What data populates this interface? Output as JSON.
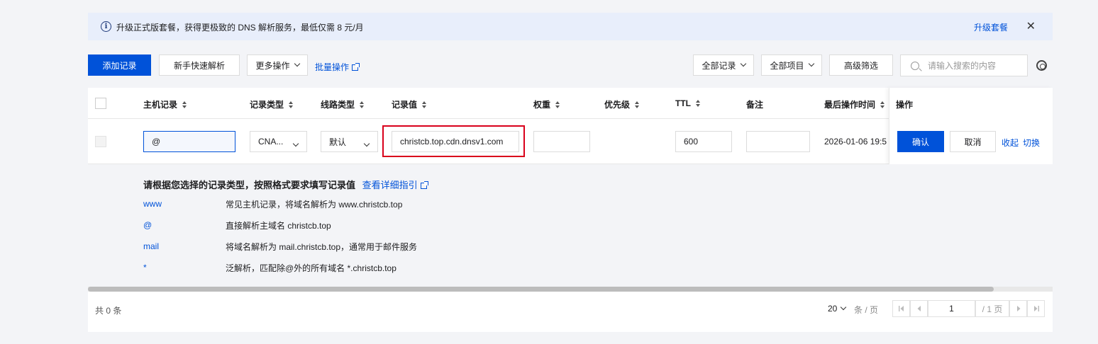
{
  "banner": {
    "message": "升级正式版套餐，获得更极致的 DNS 解析服务，最低仅需 8 元/月",
    "upgrade_link": "升级套餐",
    "close": "✕"
  },
  "toolbar": {
    "add_record": "添加记录",
    "quick_setup": "新手快速解析",
    "more_actions": "更多操作",
    "batch_ops": "批量操作",
    "filter_records": "全部记录",
    "filter_items": "全部项目",
    "advanced_filter": "高级筛选",
    "search_placeholder": "请输入搜索的内容"
  },
  "table": {
    "columns": [
      "主机记录",
      "记录类型",
      "线路类型",
      "记录值",
      "权重",
      "优先级",
      "TTL",
      "备注",
      "最后操作时间",
      "操作"
    ],
    "edit_row": {
      "host": "@",
      "type": "CNA...",
      "line": "默认",
      "value": "christcb.top.cdn.dnsv1.com",
      "weight": "",
      "ttl": "600",
      "remark": "",
      "last_modified": "2026-01-06 19:5",
      "confirm": "确认",
      "cancel": "取消",
      "collapse": "收起",
      "switch": "切换"
    }
  },
  "guide": {
    "title": "请根据您选择的记录类型，按照格式要求填写记录值",
    "detail_link": "查看详细指引",
    "examples": [
      {
        "key": "www",
        "desc": "常见主机记录，将域名解析为 www.christcb.top"
      },
      {
        "key": "@",
        "desc": "直接解析主域名 christcb.top"
      },
      {
        "key": "mail",
        "desc": "将域名解析为 mail.christcb.top，通常用于邮件服务"
      },
      {
        "key": "*",
        "desc": "泛解析，匹配除@外的所有域名 *.christcb.top"
      }
    ]
  },
  "footer": {
    "total": "共 0 条",
    "page_size": "20",
    "per_page": "条 / 页",
    "current_page": "1",
    "total_pages": "/ 1 页"
  },
  "colors": {
    "primary": "#0052d9",
    "highlight": "#d9001b",
    "banner_bg": "#e8eefb"
  }
}
